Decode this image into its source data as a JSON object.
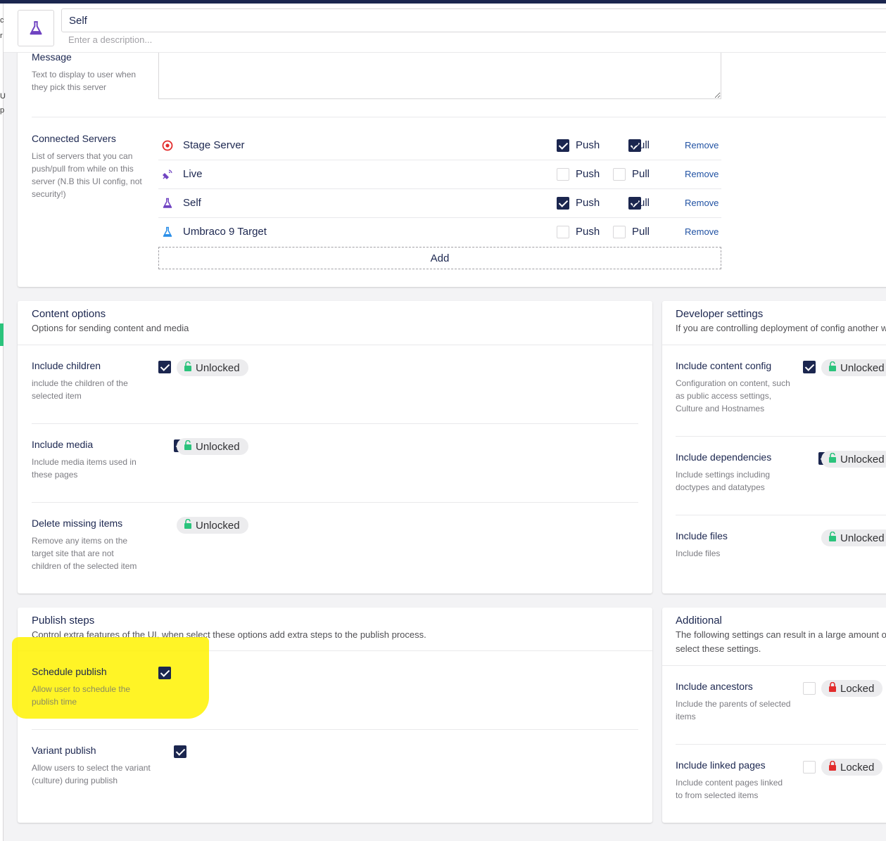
{
  "header": {
    "name_value": "Self",
    "description_placeholder": "Enter a description..."
  },
  "left_strip": {
    "chars": [
      "c",
      "r",
      "U",
      "p"
    ]
  },
  "server": {
    "message_label": "Message",
    "message_desc": "Text to display to user when they pick this server",
    "message_value": "",
    "connected_label": "Connected Servers",
    "connected_desc": "List of servers that you can push/pull from while on this server (N.B this UI config, not security!)",
    "push_label": "Push",
    "pull_label": "Pull",
    "remove_label": "Remove",
    "add_label": "Add",
    "servers": [
      {
        "name": "Stage Server",
        "icon": "target-icon",
        "push": true,
        "pull": true
      },
      {
        "name": "Live",
        "icon": "satellite-icon",
        "push": false,
        "pull": false
      },
      {
        "name": "Self",
        "icon": "flask-icon",
        "push": true,
        "pull": true
      },
      {
        "name": "Umbraco 9 Target",
        "icon": "flask-icon",
        "push": false,
        "pull": false
      }
    ]
  },
  "content_options": {
    "title": "Content options",
    "subtitle": "Options for sending content and media",
    "items": [
      {
        "label": "Include children",
        "desc": "include the children of the selected item",
        "checked": true,
        "lock": "Unlocked"
      },
      {
        "label": "Include media",
        "desc": "Include media items used in these pages",
        "checked": true,
        "lock": "Unlocked"
      },
      {
        "label": "Delete missing items",
        "desc": "Remove any items on the target site that are not children of the selected item",
        "checked": true,
        "lock": "Unlocked"
      }
    ]
  },
  "developer_settings": {
    "title": "Developer settings",
    "subtitle": "If you are controlling deployment of config another w",
    "items": [
      {
        "label": "Include content config",
        "desc": "Configuration on content, such as public access settings, Culture and Hostnames",
        "checked": true,
        "lock": "Unlocked"
      },
      {
        "label": "Include dependencies",
        "desc": "Include settings including doctypes and datatypes",
        "checked": true,
        "lock": "Unlocked"
      },
      {
        "label": "Include files",
        "desc": "Include files",
        "checked": true,
        "lock": "Unlocked"
      }
    ]
  },
  "publish_steps": {
    "title": "Publish steps",
    "subtitle": "Control extra features of the UI, when select these options add extra steps to the publish process.",
    "items": [
      {
        "label": "Schedule publish",
        "desc": "Allow user to schedule the publish time",
        "checked": true
      },
      {
        "label": "Variant publish",
        "desc": "Allow users to select the variant (culture) during publish",
        "checked": true
      }
    ]
  },
  "additional": {
    "title": "Additional",
    "subtitle_1": "The following settings can result in a large amount of",
    "subtitle_2": "select these settings.",
    "items": [
      {
        "label": "Include ancestors",
        "desc": "Include the parents of selected items",
        "checked": false,
        "lock": "Locked"
      },
      {
        "label": "Include linked pages",
        "desc": "Include content pages linked to from selected items",
        "checked": false,
        "lock": "Locked"
      }
    ]
  },
  "colors": {
    "brand_navy": "#1b264f",
    "unlock_green": "#2bc37c",
    "lock_red": "#e22c2c",
    "highlight_yellow": "#fff200",
    "link_blue": "#2152a3"
  }
}
